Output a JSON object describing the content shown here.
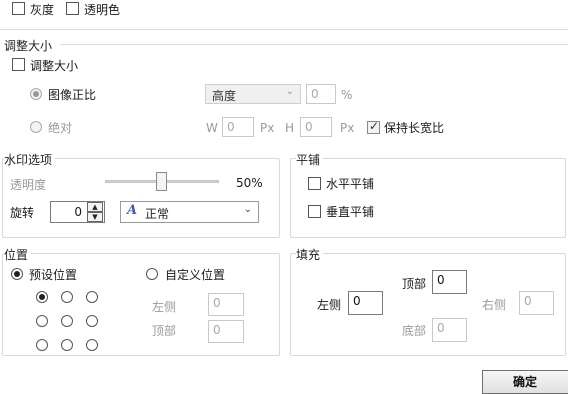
{
  "top": {
    "grayscale": "灰度",
    "transparent_color": "透明色"
  },
  "resize": {
    "section_title": "调整大小",
    "checkbox_label": "调整大小",
    "proportional_label": "图像正比",
    "dimension_select": "高度",
    "percent_value": "0",
    "percent_unit": "%",
    "absolute_label": "绝对",
    "w_label": "W",
    "w_value": "0",
    "w_unit": "Px",
    "h_label": "H",
    "h_value": "0",
    "h_unit": "Px",
    "keep_ratio_label": "保持长宽比"
  },
  "watermark": {
    "title": "水印选项",
    "opacity_label": "透明度",
    "opacity_value": "50%",
    "opacity_level": 0.5,
    "rotate_label": "旋转",
    "rotate_value": "0",
    "blend_mode": "正常"
  },
  "tile": {
    "title": "平铺",
    "horizontal": "水平平铺",
    "vertical": "垂直平铺"
  },
  "position": {
    "title": "位置",
    "preset_label": "预设位置",
    "custom_label": "自定义位置",
    "left_label": "左侧",
    "left_value": "0",
    "top_label": "顶部",
    "top_value": "0"
  },
  "fill": {
    "title": "填充",
    "top_label": "顶部",
    "top_value": "0",
    "left_label": "左侧",
    "left_value": "0",
    "right_label": "右侧",
    "right_value": "0",
    "bottom_label": "底部",
    "bottom_value": "0"
  },
  "footer": {
    "ok_label": "确定"
  }
}
